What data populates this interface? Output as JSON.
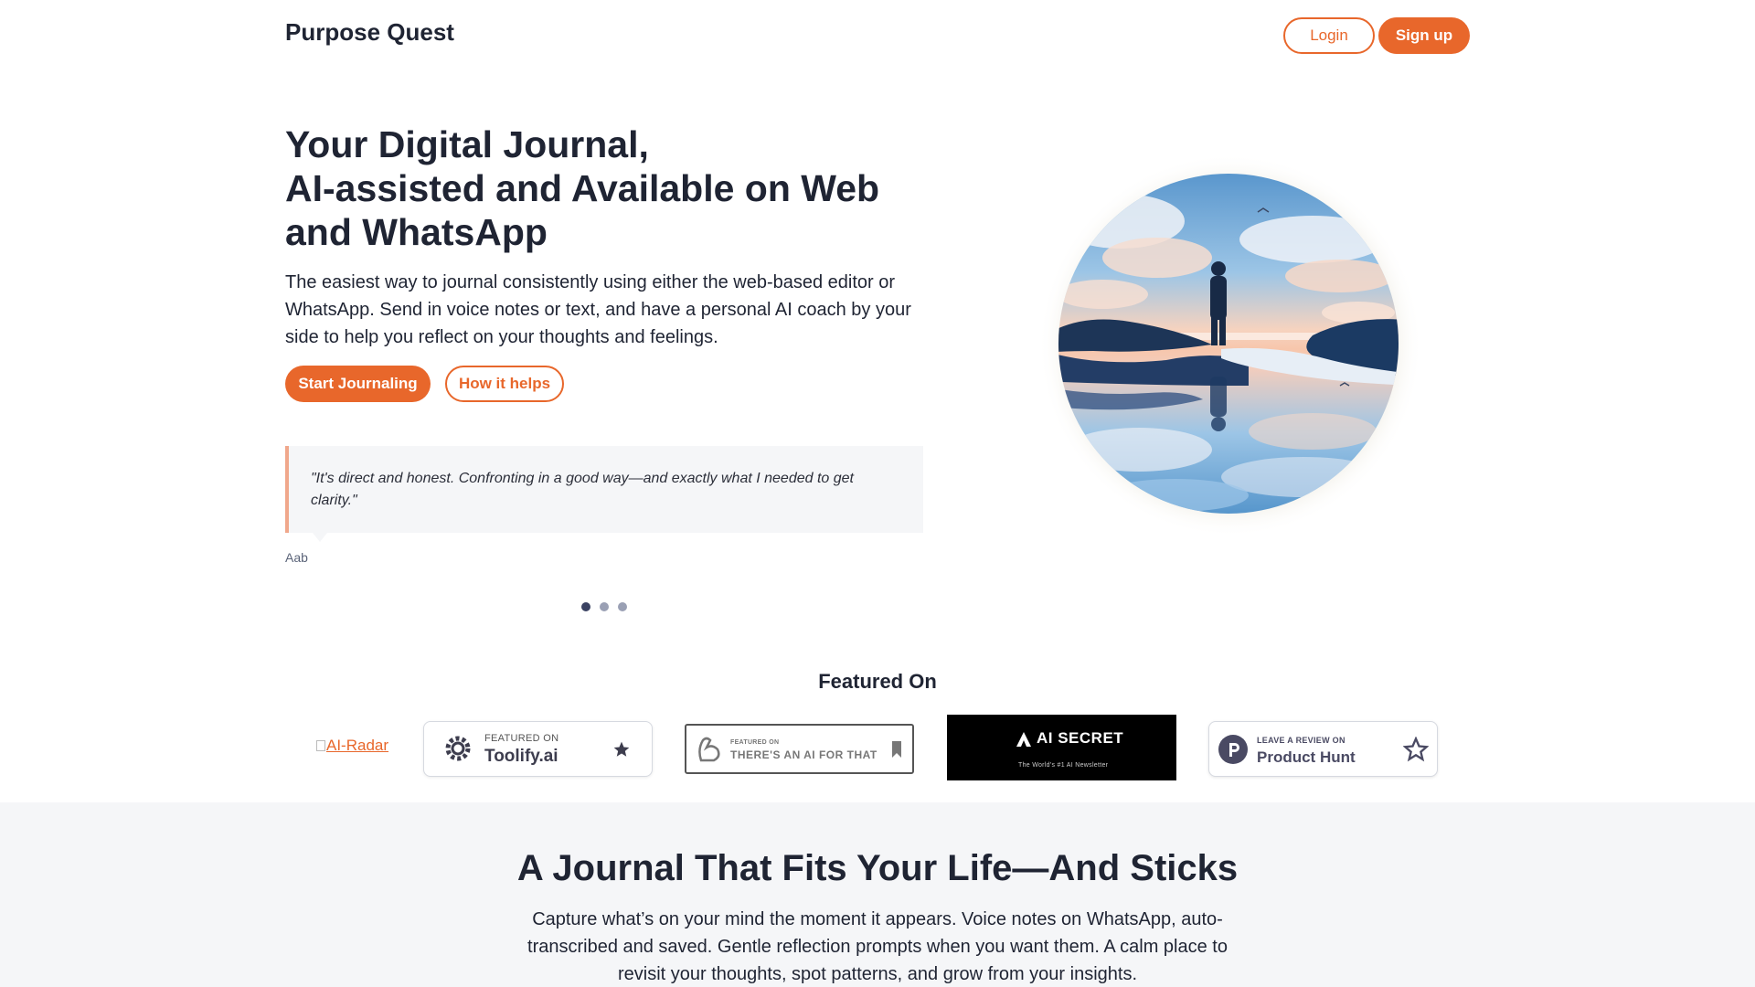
{
  "header": {
    "brand": "Purpose Quest",
    "login_label": "Login",
    "signup_label": "Sign up"
  },
  "hero": {
    "title_line1": "Your Digital Journal,",
    "title_line2": "AI-assisted and Available on Web",
    "title_line3": "and WhatsApp",
    "description": "The easiest way to journal consistently using either the web-based editor or WhatsApp. Send in voice notes or text, and have a personal AI coach by your side to help you reflect on your thoughts and feelings.",
    "start_label": "Start Journaling",
    "how_label": "How it helps"
  },
  "testimonial": {
    "quote": "\"It's direct and honest. Confronting in a good way—and exactly what I needed to get clarity.\"",
    "author": "Aab",
    "slide_count": 3,
    "active_slide": 1
  },
  "featured": {
    "title": "Featured On",
    "airadar_alt": "AI-Radar",
    "toolify_small": "FEATURED ON",
    "toolify_big": "Toolify.ai",
    "taaft_small": "FEATURED ON",
    "taaft_big": "THERE'S AN AI FOR THAT",
    "aisecret_big": "AI SECRET",
    "aisecret_small": "The World's #1 AI Newsletter",
    "ph_small": "LEAVE A REVIEW ON",
    "ph_big": "Product Hunt"
  },
  "section2": {
    "title": "A Journal That Fits Your Life—And Sticks",
    "description": "Capture what’s on your mind the moment it appears. Voice notes on WhatsApp, auto-transcribed and saved. Gentle reflection prompts when you want them. A calm place to revisit your thoughts, spot patterns, and grow from your insights."
  },
  "colors": {
    "accent": "#e8672b",
    "text": "#1f2433",
    "quote_bg": "#f5f6f8"
  },
  "icons": [
    "toolify-gear-icon",
    "star-icon",
    "bicep-icon",
    "bookmark-icon",
    "aisecret-logo-icon",
    "producthunt-icon",
    "star-outline-icon"
  ]
}
